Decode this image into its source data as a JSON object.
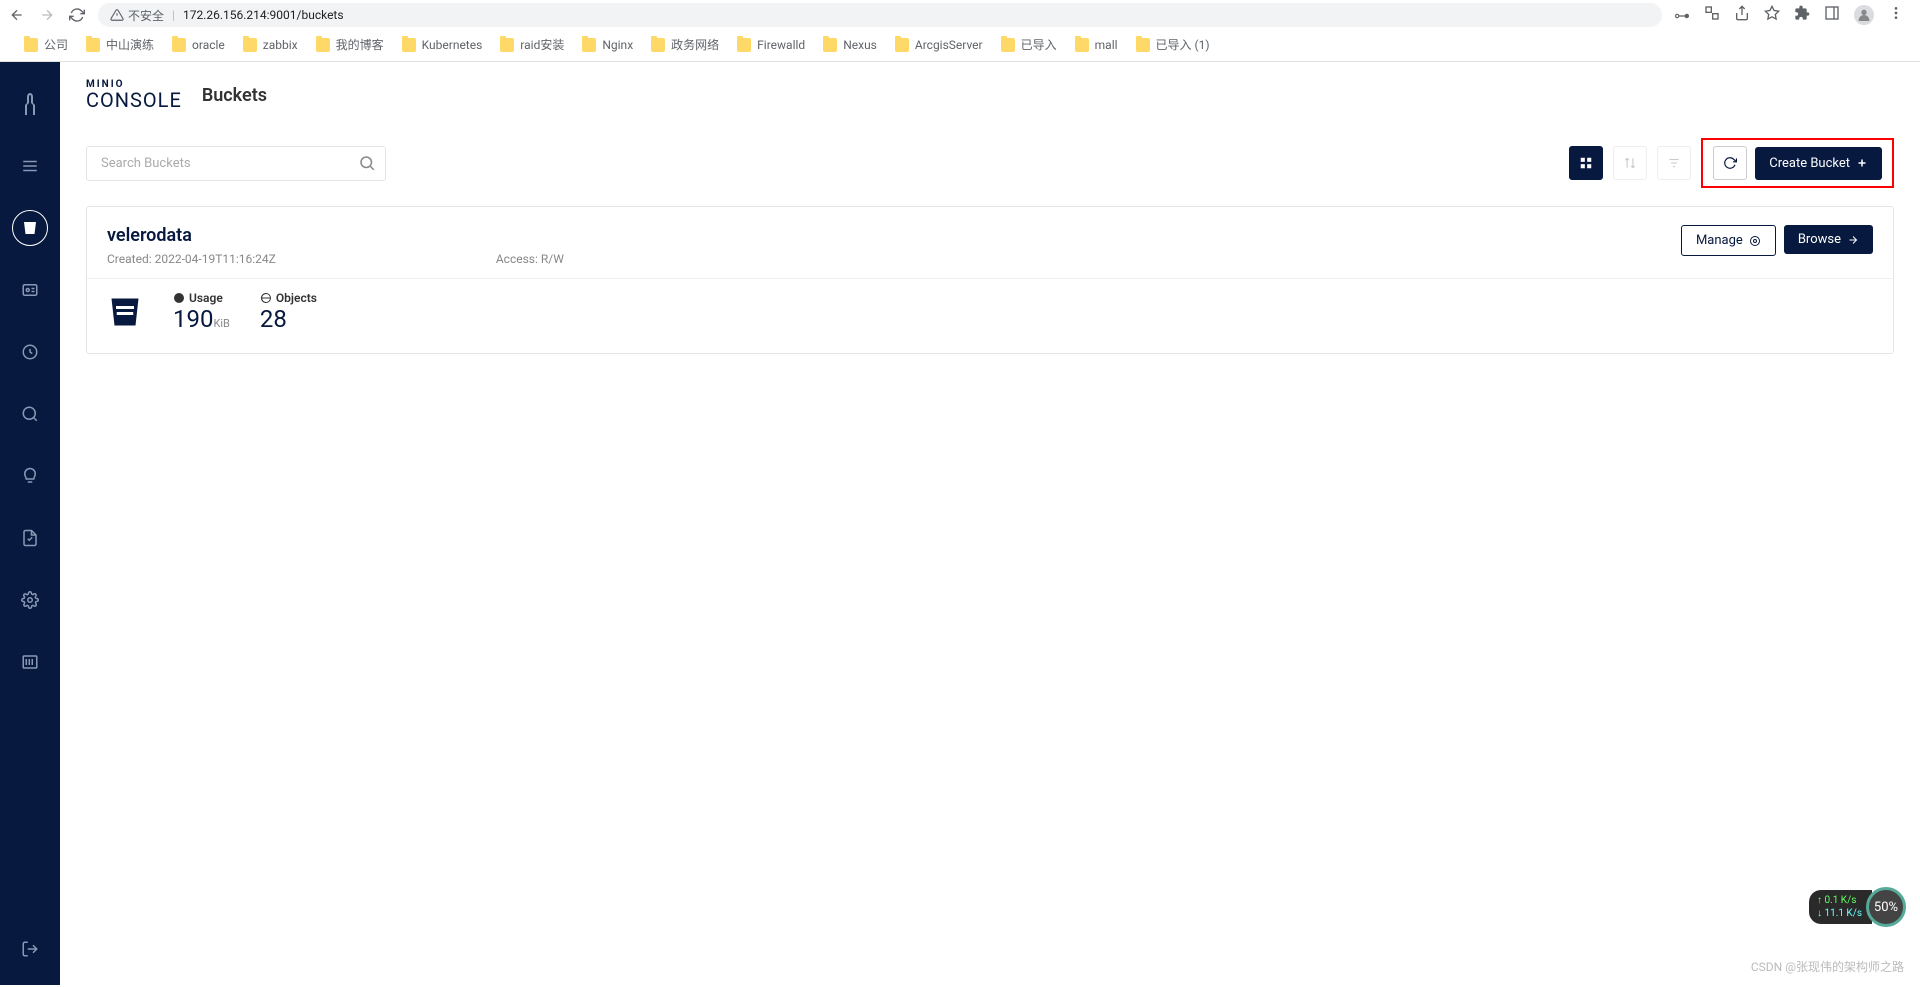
{
  "browser": {
    "security_text": "不安全",
    "url": "172.26.156.214:9001/buckets",
    "bookmarks": [
      "公司",
      "中山演练",
      "oracle",
      "zabbix",
      "我的博客",
      "Kubernetes",
      "raid安装",
      "Nginx",
      "政务网络",
      "Firewalld",
      "Nexus",
      "ArcgisServer",
      "已导入",
      "mall",
      "已导入 (1)"
    ]
  },
  "header": {
    "logo_top": "MINIO",
    "logo_bottom": "CONSOLE",
    "page_title": "Buckets"
  },
  "toolbar": {
    "search_placeholder": "Search Buckets",
    "create_label": "Create Bucket"
  },
  "bucket": {
    "name": "velerodata",
    "created_label": "Created:",
    "created_value": "2022-04-19T11:16:24Z",
    "access_label": "Access:",
    "access_value": "R/W",
    "manage_label": "Manage",
    "browse_label": "Browse",
    "usage_label": "Usage",
    "usage_value": "190",
    "usage_unit": "KiB",
    "objects_label": "Objects",
    "objects_value": "28"
  },
  "net": {
    "up": "↑ 0.1 K/s",
    "down": "↓ 11.1 K/s",
    "percent": "50%"
  },
  "watermark": "CSDN @张现伟的架构师之路"
}
